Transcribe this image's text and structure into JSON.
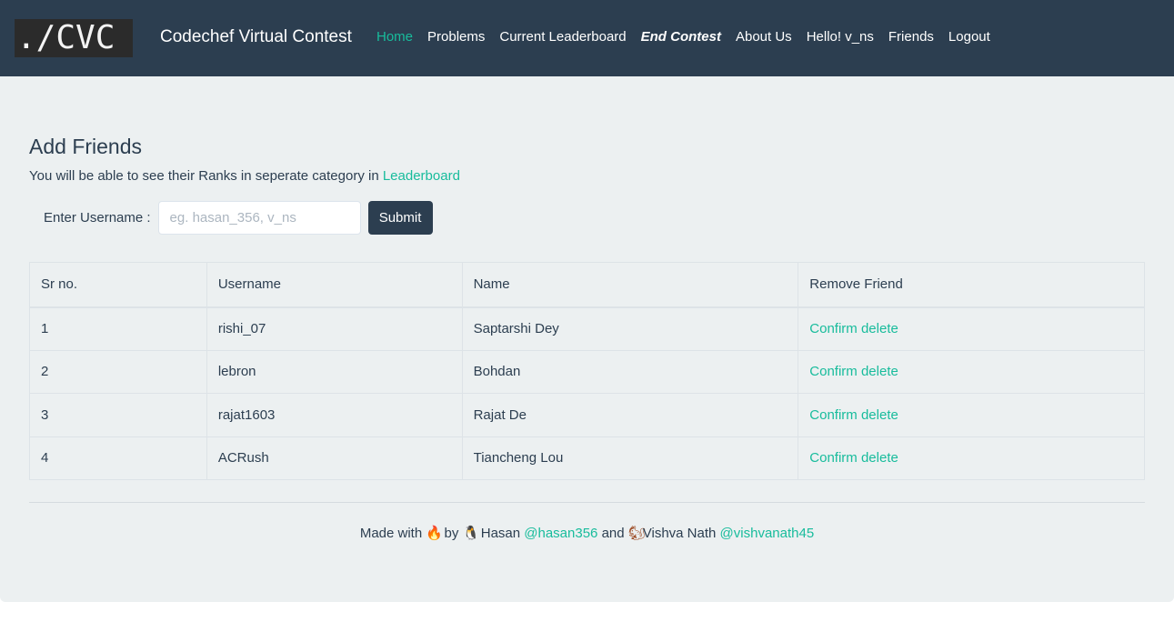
{
  "navbar": {
    "logo_text": "./CVC",
    "brand": "Codechef Virtual Contest",
    "links": [
      {
        "label": "Home"
      },
      {
        "label": "Problems"
      },
      {
        "label": "Current Leaderboard"
      },
      {
        "label": "End Contest"
      },
      {
        "label": "About Us"
      },
      {
        "label": "Hello! v_ns"
      },
      {
        "label": "Friends"
      },
      {
        "label": "Logout"
      }
    ],
    "colors": {
      "background": "#2c3e50",
      "active": "#18bc9c"
    }
  },
  "main": {
    "title": "Add Friends",
    "subtitle_prefix": "You will be able to see their Ranks in seperate category in ",
    "subtitle_link": "Leaderboard",
    "form": {
      "label": "Enter Username :",
      "placeholder": "eg. hasan_356, v_ns",
      "value": "",
      "submit_label": "Submit"
    },
    "table": {
      "headers": [
        "Sr no.",
        "Username",
        "Name",
        "Remove Friend"
      ],
      "rows": [
        {
          "sr": "1",
          "username": "rishi_07",
          "name": "Saptarshi Dey",
          "action": "Confirm delete"
        },
        {
          "sr": "2",
          "username": "lebron",
          "name": "Bohdan",
          "action": "Confirm delete"
        },
        {
          "sr": "3",
          "username": "rajat1603",
          "name": "Rajat De",
          "action": "Confirm delete"
        },
        {
          "sr": "4",
          "username": "ACRush",
          "name": "Tiancheng Lou",
          "action": "Confirm delete"
        }
      ]
    }
  },
  "footer": {
    "made_with": "Made with",
    "by": "by",
    "author1_name": "Hasan",
    "author1_handle": "@hasan356",
    "and": "and",
    "author2_name": "Vishva Nath",
    "author2_handle": "@vishvanath45",
    "icons": [
      "fire-icon",
      "penguin-icon",
      "squirrel-icon"
    ]
  },
  "colors": {
    "page_bg": "#ecf0f1",
    "link": "#18bc9c",
    "text": "#2c3e50"
  }
}
